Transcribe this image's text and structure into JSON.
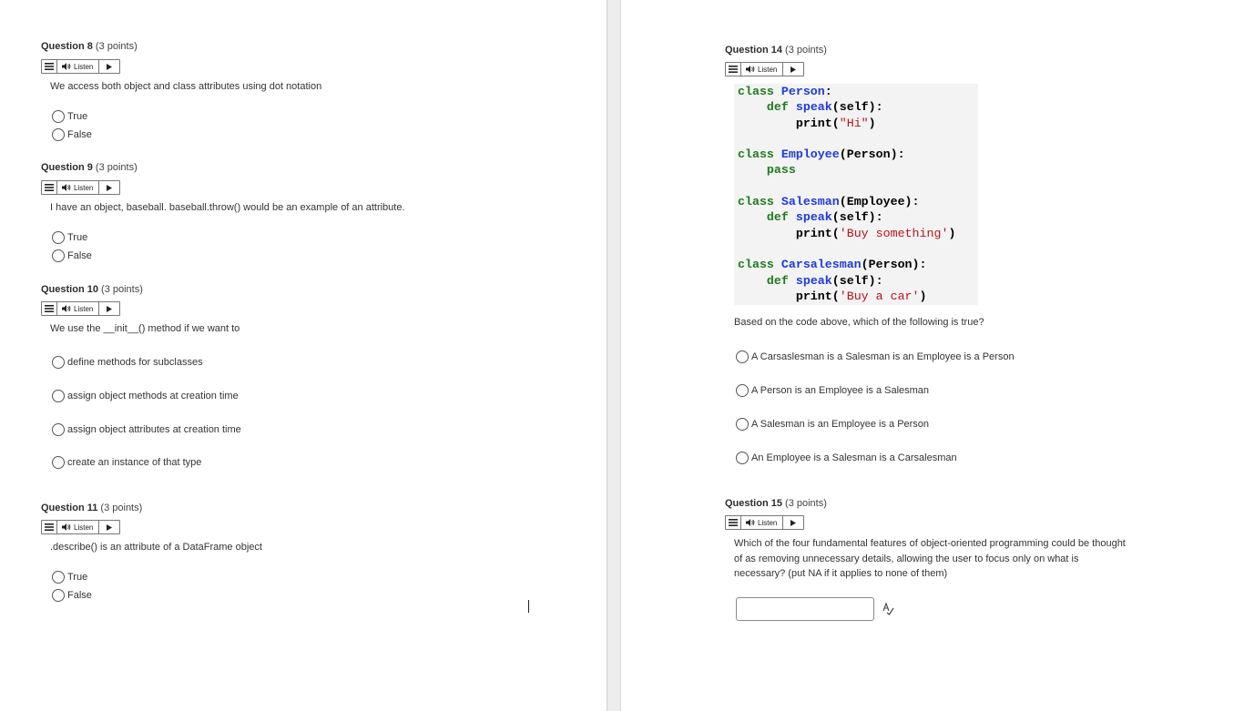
{
  "listen_label": "Listen",
  "left_questions": [
    {
      "number": "Question 8",
      "points": "(3 points)",
      "prompt": "We access both object and class attributes using dot notation",
      "options": [
        "True",
        "False"
      ]
    },
    {
      "number": "Question 9",
      "points": "(3 points)",
      "prompt": "I have an object, baseball.  baseball.throw() would be an example of an attribute.",
      "options": [
        "True",
        "False"
      ]
    },
    {
      "number": "Question 10",
      "points": "(3 points)",
      "prompt": "We use the __init__() method if we want to",
      "options": [
        "define methods for subclasses",
        "assign object methods at creation time",
        "assign object attributes at creation time",
        "create an instance of that type"
      ]
    },
    {
      "number": "Question 11",
      "points": "(3 points)",
      "prompt": ".describe() is an attribute of a DataFrame object",
      "options": [
        "True",
        "False"
      ]
    }
  ],
  "q14": {
    "number": "Question 14",
    "points": "(3 points)",
    "code": {
      "cls_kw": "class",
      "person": "Person",
      "employee": "Employee",
      "salesman": "Salesman",
      "carsalesman": "Carsalesman",
      "def_kw": "def",
      "speak": "speak",
      "self_args": "(self):",
      "colon": ":",
      "print_fn": "print(",
      "close_paren": ")",
      "hi_str": "\"Hi\"",
      "employee_parent": "(Person):",
      "salesman_parent": "(Employee):",
      "carsalesman_parent": "(Person):",
      "pass_kw": "pass",
      "buy_something": "'Buy something'",
      "buy_car": "'Buy a car'"
    },
    "prompt": "Based on the code above, which of the following is true?",
    "options": [
      "A Carsaslesman is a Salesman is an Employee is a Person",
      "A Person is an Employee is a Salesman",
      "A Salesman is an Employee is a Person",
      "An Employee is a Salesman is a Carsalesman"
    ]
  },
  "q15": {
    "number": "Question 15",
    "points": "(3 points)",
    "prompt": "Which of the four fundamental features of object-oriented programming could be thought of as removing unnecessary details, allowing the user to focus only on what is necessary? (put NA if it applies to none of them)",
    "answer_value": ""
  }
}
